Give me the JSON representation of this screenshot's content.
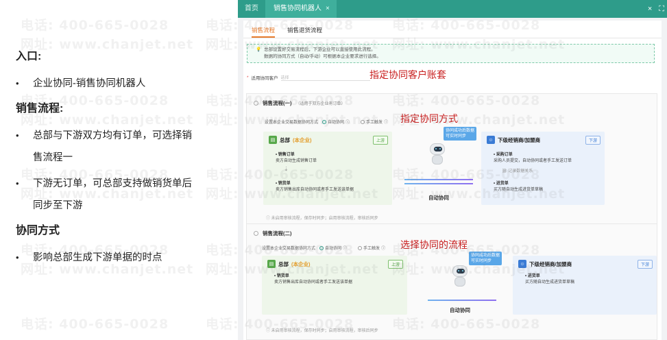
{
  "notes": {
    "entry_heading": "入口:",
    "entry_items": [
      {
        "text": "企业协同-销售协同机器人"
      }
    ],
    "sales_heading": "销售流程:",
    "sales_items": [
      {
        "line1": "总部与下游双方均有订单，可选择销",
        "line2": "售流程一"
      },
      {
        "line1": "下游无订单，可总部支持做销货单后",
        "line2": "同步至下游"
      }
    ],
    "mode_heading": "协同方式",
    "mode_items": [
      {
        "text": "影响总部生成下游单据的时点"
      }
    ]
  },
  "app": {
    "tabs": {
      "home": "首页",
      "active": "销售协同机器人",
      "close": "×"
    },
    "window_controls": {
      "close": "×",
      "expand": "⛶"
    },
    "subtabs": [
      "销售流程",
      "销售退货流程"
    ],
    "tips": [
      "总部设置好交易流程后，下游企业可以直接使用此流程。",
      "数据的协同方式（自动/手动）可根据本企业要求进行选择。"
    ],
    "customer_label": "适用协同客户",
    "customer_placeholder": "选择",
    "flow1": {
      "title": "销售流程(一)",
      "subtitle": "（适用于双方企业有订单）",
      "mode_label": "设置本企业交易数据协同方式",
      "auto": "自动协同",
      "manual": "手工触发",
      "hq": {
        "name": "总部",
        "own": "(本企业)",
        "badge": "上游",
        "doc1": "销售订单",
        "doc1_desc": "卖方自动生成销售订单",
        "doc2": "销货单",
        "doc2_desc": "卖方销售出库自动协同或者手工发送该单据"
      },
      "bubble": [
        "协同成功后数据",
        "可实时同步"
      ],
      "sync": "自动协同",
      "down": {
        "name": "下级经销商/加盟商",
        "badge": "下游",
        "doc1": "采购订单",
        "doc1_desc": "采购人员提交，自动协同或者手工发送订单",
        "link": "记录数据关系",
        "doc2": "进货单",
        "doc2_desc": "买方随自动生成进货单草稿"
      },
      "footnote": "未启用审核流程，保存时同步；启用审核流程，审核后同步"
    },
    "flow2": {
      "title": "销售流程(二)",
      "mode_label": "设置本企业交易数据协同方式",
      "auto": "自动协同",
      "manual": "手工触发",
      "hq": {
        "name": "总部",
        "own": "(本企业)",
        "badge": "上游",
        "doc1": "销货单",
        "doc1_desc": "卖方销售出库自动协同或者手工发送该单据"
      },
      "bubble": [
        "协同成功后数据",
        "可实时同步"
      ],
      "sync": "自动协同",
      "down": {
        "name": "下级经销商/加盟商",
        "badge": "下游",
        "doc1": "进货单",
        "doc1_desc": "买方随自动生成进货单草稿"
      },
      "footnote": "未启用审核流程，保存时同步；启用审核流程，审核后同步"
    }
  },
  "annotations": {
    "customer": "指定协同客户账套",
    "mode": "指定协同方式",
    "flow": "选择协同的流程"
  },
  "watermarks": {
    "phone": "电话: 400-665-0028",
    "site": "网址: www.chanjet.net"
  },
  "colors": {
    "titlebar": "#2e9c8a",
    "accent": "#e77b2b",
    "annotation": "#c81e1e"
  }
}
